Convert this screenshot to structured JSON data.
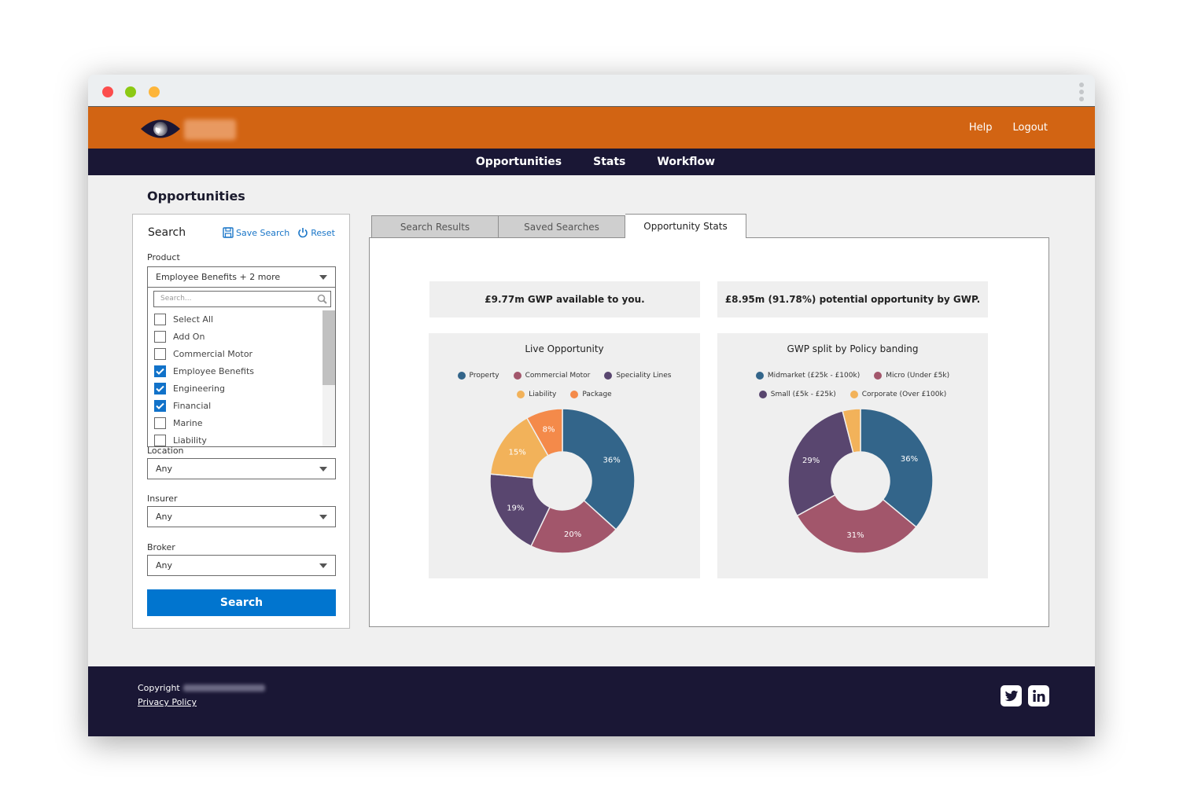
{
  "window": {
    "controls": [
      "close",
      "minimize",
      "maximize"
    ]
  },
  "header": {
    "links": [
      {
        "label": "Help"
      },
      {
        "label": "Logout"
      }
    ]
  },
  "nav": {
    "items": [
      {
        "label": "Opportunities"
      },
      {
        "label": "Stats"
      },
      {
        "label": "Workflow"
      }
    ]
  },
  "page": {
    "title": "Opportunities"
  },
  "search_panel": {
    "title": "Search",
    "save_search_label": "Save Search",
    "reset_label": "Reset",
    "product": {
      "label": "Product",
      "value": "Employee Benefits + 2 more",
      "search_placeholder": "Search...",
      "options": [
        {
          "label": "Select All",
          "checked": false
        },
        {
          "label": "Add On",
          "checked": false
        },
        {
          "label": "Commercial Motor",
          "checked": false
        },
        {
          "label": "Employee Benefits",
          "checked": true
        },
        {
          "label": "Engineering",
          "checked": true
        },
        {
          "label": "Financial",
          "checked": true
        },
        {
          "label": "Marine",
          "checked": false
        },
        {
          "label": "Liability",
          "checked": false
        }
      ]
    },
    "location": {
      "label": "Location",
      "value": "Any"
    },
    "insurer": {
      "label": "Insurer",
      "value": "Any"
    },
    "broker": {
      "label": "Broker",
      "value": "Any"
    },
    "search_button": "Search"
  },
  "tabs": [
    {
      "label": "Search Results",
      "active": false
    },
    {
      "label": "Saved Searches",
      "active": false
    },
    {
      "label": "Opportunity Stats",
      "active": true
    }
  ],
  "kpis": [
    {
      "text": "£9.77m GWP available to you."
    },
    {
      "text": "£8.95m (91.78%) potential opportunity by GWP."
    }
  ],
  "chart_data": [
    {
      "type": "pie",
      "donut": true,
      "title": "Live Opportunity",
      "categories": [
        "Property",
        "Commercial Motor",
        "Speciality Lines",
        "Liability",
        "Package"
      ],
      "values": [
        36,
        20,
        19,
        15,
        8
      ],
      "labels": [
        "36%",
        "20%",
        "19%",
        "15%",
        "8%"
      ],
      "colors": [
        "#33658a",
        "#a2566b",
        "#59466f",
        "#f2b25a",
        "#f48a4a"
      ],
      "legend_rows": [
        [
          "Property",
          "Commercial Motor",
          "Speciality Lines"
        ],
        [
          "Liability",
          "Package"
        ]
      ],
      "legend": "top"
    },
    {
      "type": "pie",
      "donut": true,
      "title": "GWP split by Policy banding",
      "categories": [
        "Midmarket (£25k - £100k)",
        "Micro (Under £5k)",
        "Small (£5k - £25k)",
        "Corporate (Over £100k)"
      ],
      "values": [
        36,
        31,
        29,
        4
      ],
      "labels": [
        "36%",
        "31%",
        "29%",
        ""
      ],
      "colors": [
        "#33658a",
        "#a2566b",
        "#59466f",
        "#f2b25a"
      ],
      "legend_rows": [
        [
          "Midmarket (£25k - £100k)",
          "Micro (Under £5k)"
        ],
        [
          "Small (£5k - £25k)",
          "Corporate (Over £100k)"
        ]
      ],
      "legend": "top"
    }
  ],
  "footer": {
    "copyright_label": "Copyright",
    "privacy_label": "Privacy Policy",
    "social": [
      "twitter-icon",
      "linkedin-icon"
    ]
  },
  "colors": {
    "brand_orange": "#d26413",
    "navy": "#1a1735",
    "primary_blue": "#0175cf"
  }
}
